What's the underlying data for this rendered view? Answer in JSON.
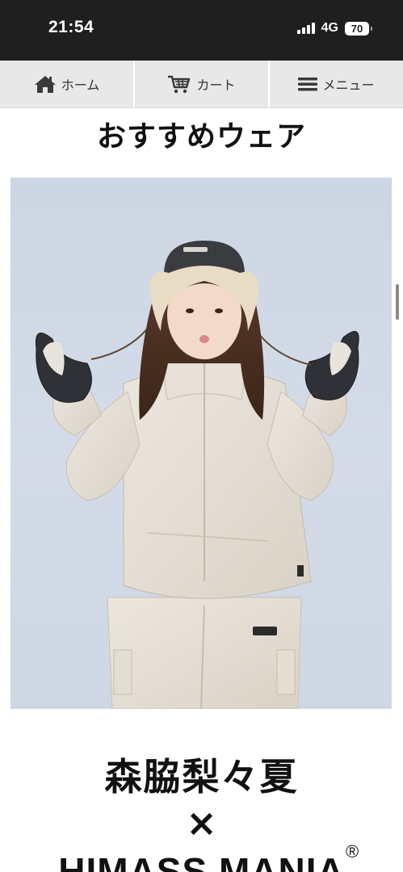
{
  "status_bar": {
    "time": "21:54",
    "network": "4G",
    "battery": "70"
  },
  "nav": {
    "home_label": "ホーム",
    "cart_label": "カート",
    "menu_label": "メニュー"
  },
  "section": {
    "title": "おすすめウェア"
  },
  "hero": {
    "icon": "snowwear-model-photo"
  },
  "collab": {
    "name": "森脇梨々夏",
    "cross": "×",
    "brand": "HIMASS MANIA",
    "registered": "®"
  },
  "colors": {
    "status_bar_bg": "#1f1f1f",
    "nav_bg": "#e8e8e8",
    "hero_bg": "#cfd7e4",
    "text": "#111111"
  }
}
